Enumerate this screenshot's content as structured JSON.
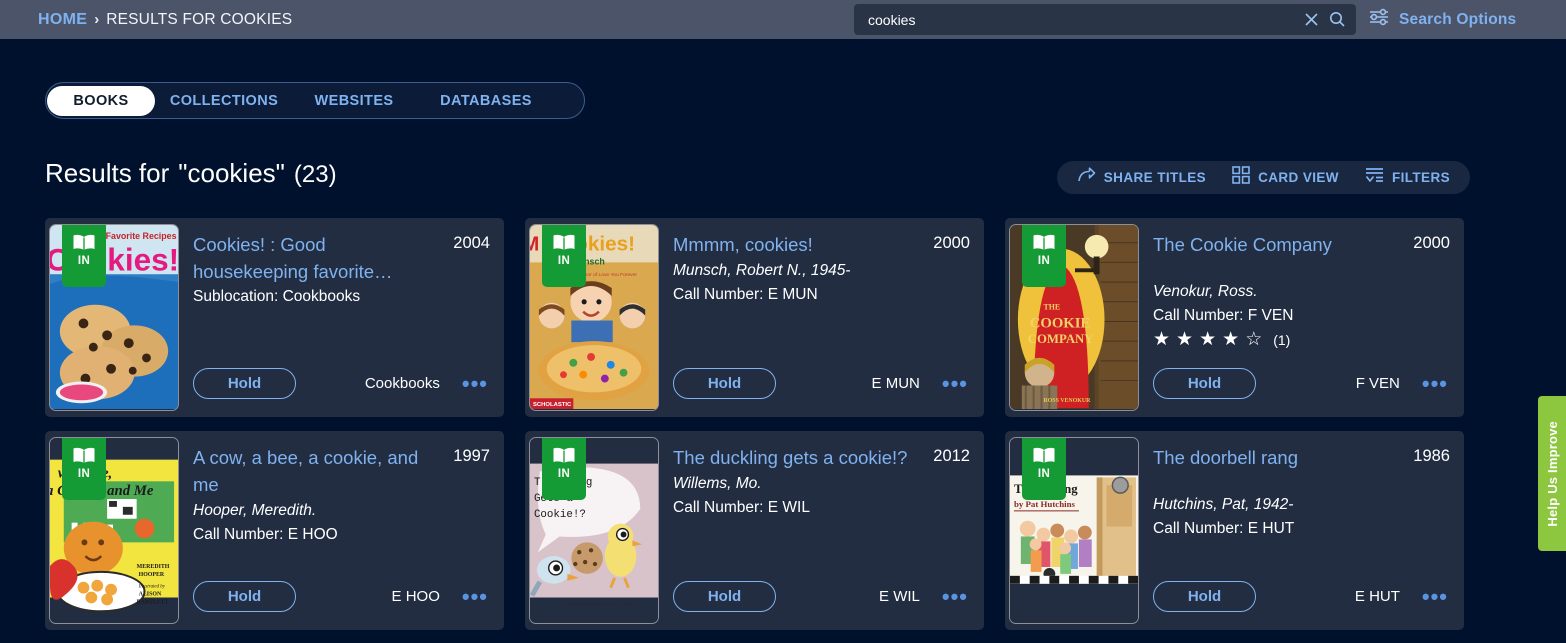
{
  "header": {
    "breadcrumb": {
      "home": "HOME",
      "separator": "›",
      "current": "RESULTS FOR COOKIES"
    },
    "search": {
      "value": "cookies",
      "placeholder": "Search",
      "clear_icon": "close-icon",
      "submit_icon": "search-icon"
    },
    "search_options_label": "Search Options",
    "search_options_icon": "sliders-icon",
    "bar_color": "#4c5469",
    "link_color": "#7fb2ef"
  },
  "tabs": [
    {
      "label": "BOOKS",
      "active": true
    },
    {
      "label": "COLLECTIONS",
      "active": false
    },
    {
      "label": "WEBSITES",
      "active": false
    },
    {
      "label": "DATABASES",
      "active": false
    }
  ],
  "results": {
    "title": "Results for",
    "query": "\"cookies\"",
    "count": "(23)"
  },
  "toolbar": [
    {
      "label": "SHARE TITLES",
      "icon": "share-icon"
    },
    {
      "label": "CARD VIEW",
      "icon": "grid-view-icon"
    },
    {
      "label": "FILTERS",
      "icon": "filters-icon"
    }
  ],
  "common": {
    "hold_label": "Hold",
    "more_label": "•••",
    "status_badge": "IN",
    "badge_color": "#159b36",
    "card_color": "#222d42",
    "page_bg": "#00112e"
  },
  "cards": [
    {
      "title": "Cookies! : Good housekeeping favorite…",
      "year": "2004",
      "author": "",
      "sublocation": "Sublocation: Cookbooks",
      "call_number": "",
      "foot_call": "Cookbooks",
      "rating": null,
      "rating_count": "",
      "status": "IN"
    },
    {
      "title": "Mmmm, cookies!",
      "year": "2000",
      "author": "Munsch, Robert N., 1945-",
      "sublocation": "",
      "call_number": "Call Number: E MUN",
      "foot_call": "E MUN",
      "rating": null,
      "rating_count": "",
      "status": "IN"
    },
    {
      "title": "The Cookie Company",
      "year": "2000",
      "author": "Venokur, Ross.",
      "sublocation": "",
      "call_number": "Call Number: F VEN",
      "foot_call": "F VEN",
      "rating": 4,
      "rating_count": "(1)",
      "status": "IN"
    },
    {
      "title": "A cow, a bee, a cookie, and me",
      "year": "1997",
      "author": "Hooper, Meredith.",
      "sublocation": "",
      "call_number": "Call Number: E HOO",
      "foot_call": "E HOO",
      "rating": null,
      "rating_count": "",
      "status": "IN"
    },
    {
      "title": "The duckling gets a cookie!?",
      "year": "2012",
      "author": "Willems, Mo.",
      "sublocation": "",
      "call_number": "Call Number: E WIL",
      "foot_call": "E WIL",
      "rating": null,
      "rating_count": "",
      "status": "IN"
    },
    {
      "title": "The doorbell rang",
      "year": "1986",
      "author": "Hutchins, Pat, 1942-",
      "sublocation": "",
      "call_number": "Call Number: E HUT",
      "foot_call": "E HUT",
      "rating": null,
      "rating_count": "",
      "status": "IN"
    }
  ],
  "help_tab": {
    "label": "Help Us Improve",
    "color": "#8dc63f"
  }
}
